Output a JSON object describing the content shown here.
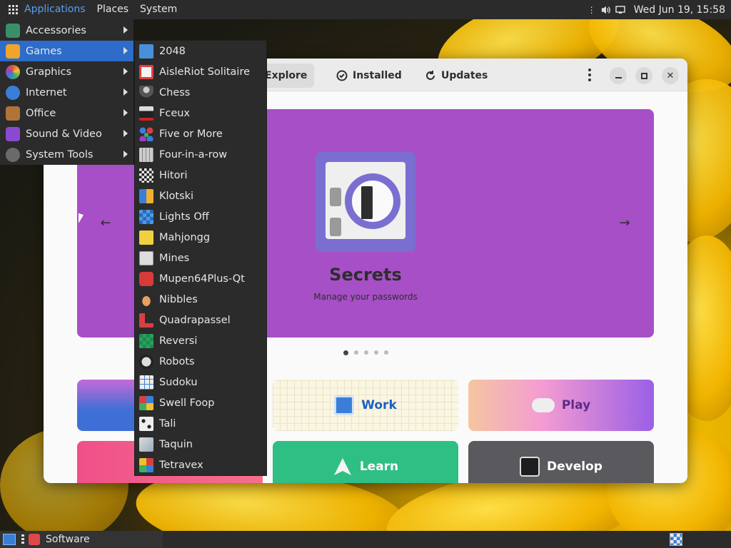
{
  "top_panel": {
    "menus": [
      "Applications",
      "Places",
      "System"
    ],
    "clock": "Wed Jun 19, 15:58"
  },
  "app_menu": {
    "items": [
      {
        "label": "Accessories",
        "icon": "accessories-icon",
        "color": "#3a8f6a"
      },
      {
        "label": "Games",
        "icon": "games-icon",
        "color": "#f0a52a"
      },
      {
        "label": "Graphics",
        "icon": "graphics-icon",
        "color": "#e05a3a"
      },
      {
        "label": "Internet",
        "icon": "internet-icon",
        "color": "#3a7ed8"
      },
      {
        "label": "Office",
        "icon": "office-icon",
        "color": "#b0733a"
      },
      {
        "label": "Sound & Video",
        "icon": "sound-video-icon",
        "color": "#8a4ad0"
      },
      {
        "label": "System Tools",
        "icon": "system-tools-icon",
        "color": "#6a6a6a"
      }
    ]
  },
  "games_menu": {
    "items": [
      {
        "label": "2048",
        "icon": "2048-icon",
        "color": "#4a90d9"
      },
      {
        "label": "AisleRiot Solitaire",
        "icon": "solitaire-icon",
        "color": "#e04040"
      },
      {
        "label": "Chess",
        "icon": "chess-icon",
        "color": "#888888"
      },
      {
        "label": "Fceux",
        "icon": "fceux-icon",
        "color": "#cc2222"
      },
      {
        "label": "Five or More",
        "icon": "five-or-more-icon",
        "color": "#3a7ed8"
      },
      {
        "label": "Four-in-a-row",
        "icon": "four-in-a-row-icon",
        "color": "#c9c9c9"
      },
      {
        "label": "Hitori",
        "icon": "hitori-icon",
        "color": "#e0e0e0"
      },
      {
        "label": "Klotski",
        "icon": "klotski-icon",
        "color": "#3a7ed8"
      },
      {
        "label": "Lights Off",
        "icon": "lights-off-icon",
        "color": "#2a6ab8"
      },
      {
        "label": "Mahjongg",
        "icon": "mahjongg-icon",
        "color": "#f0d040"
      },
      {
        "label": "Mines",
        "icon": "mines-icon",
        "color": "#dddddd"
      },
      {
        "label": "Mupen64Plus-Qt",
        "icon": "mupen-icon",
        "color": "#d83a3a"
      },
      {
        "label": "Nibbles",
        "icon": "nibbles-icon",
        "color": "#e8a060"
      },
      {
        "label": "Quadrapassel",
        "icon": "quadrapassel-icon",
        "color": "#d84040"
      },
      {
        "label": "Reversi",
        "icon": "reversi-icon",
        "color": "#2aa060"
      },
      {
        "label": "Robots",
        "icon": "robots-icon",
        "color": "#cccccc"
      },
      {
        "label": "Sudoku",
        "icon": "sudoku-icon",
        "color": "#e8e8e8"
      },
      {
        "label": "Swell Foop",
        "icon": "swell-foop-icon",
        "color": "#3a7ed8"
      },
      {
        "label": "Tali",
        "icon": "tali-icon",
        "color": "#eeeeee"
      },
      {
        "label": "Taquin",
        "icon": "taquin-icon",
        "color": "#dddddd"
      },
      {
        "label": "Tetravex",
        "icon": "tetravex-icon",
        "color": "#3a7ed8"
      }
    ]
  },
  "software": {
    "tabs": [
      "Explore",
      "Installed",
      "Updates"
    ],
    "banner": {
      "title": "Secrets",
      "subtitle": "Manage your passwords",
      "color": "#a74fc7"
    },
    "categories": [
      {
        "label": "",
        "icon": "create-icon",
        "background": "#3e6fd6",
        "text_color": "#ffffff"
      },
      {
        "label": "Work",
        "icon": "work-icon",
        "background": "#fbf6e2",
        "text_color": "#1c5fc4"
      },
      {
        "label": "Play",
        "icon": "gamepad-icon",
        "background": "#f49bd2",
        "text_color": "#5b2c8a"
      },
      {
        "label": "",
        "icon": "socialize-icon",
        "background": "#f0508a",
        "text_color": "#ffffff"
      },
      {
        "label": "Learn",
        "icon": "learn-icon",
        "background": "#2fbf84",
        "text_color": "#ffffff"
      },
      {
        "label": "Develop",
        "icon": "terminal-icon",
        "background": "#5a5a5e",
        "text_color": "#ffffff"
      }
    ]
  },
  "taskbar": {
    "task_label": "Software"
  }
}
